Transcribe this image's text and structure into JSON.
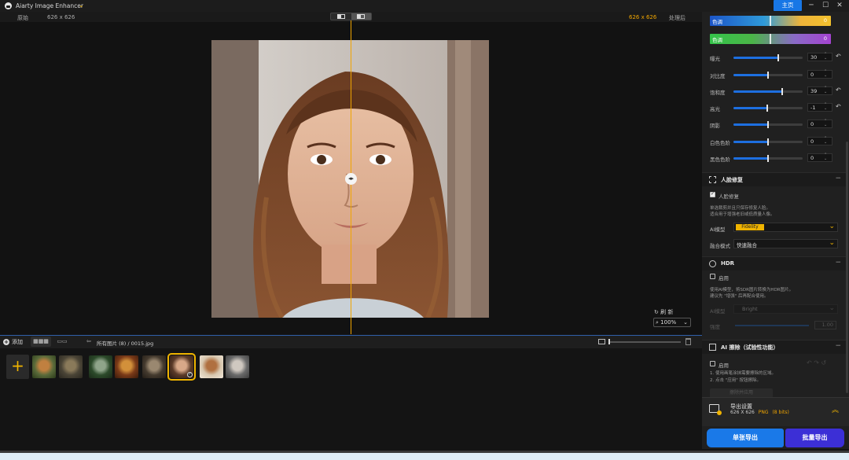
{
  "app": {
    "title": "Aiarty Image Enhancer",
    "home": "主页",
    "controls": [
      "─",
      "☐",
      "✕"
    ]
  },
  "compare": {
    "original": "原始",
    "after": "处理后",
    "size_left": "626 x 626",
    "size_right": "626 x 626"
  },
  "canvas": {
    "reset": "刷 新",
    "zoom": "100%"
  },
  "toolbar": {
    "add": "添加",
    "grid_icon": "▦▦▦",
    "list_icon": "▭▭",
    "breadcrumb": "所有图片 (8)  /  0015.jpg"
  },
  "gallery": {
    "add_symbol": "+",
    "thumbs": [
      {
        "name": "thumb-tiger",
        "colors": [
          "#5a6a3a",
          "#c08040",
          "#2a3a1a"
        ]
      },
      {
        "name": "thumb-owl",
        "colors": [
          "#4a4436",
          "#8a7a5a",
          "#2b2820"
        ]
      },
      {
        "name": "thumb-forest",
        "colors": [
          "#2c4a2a",
          "#8fa48a",
          "#1a2a18"
        ]
      },
      {
        "name": "thumb-food",
        "colors": [
          "#7a3a18",
          "#d2903a",
          "#3a1a0a"
        ]
      },
      {
        "name": "thumb-cat",
        "colors": [
          "#443a2e",
          "#9a8870",
          "#221c16"
        ]
      },
      {
        "name": "thumb-portrait",
        "colors": [
          "#5a3a28",
          "#d8a888",
          "#2a1a14"
        ],
        "selected": true
      },
      {
        "name": "thumb-dog",
        "colors": [
          "#d8c8b0",
          "#b07040",
          "#f0e6d8"
        ]
      },
      {
        "name": "thumb-street",
        "colors": [
          "#6a6a6a",
          "#cfc8c0",
          "#3a3a3a"
        ]
      }
    ]
  },
  "panel": {
    "hue_label": "色调",
    "hue_value": "0",
    "tone_label": "色调",
    "tone_value": "0",
    "adjustments": [
      {
        "label": "曝光",
        "value": "30",
        "level": 0.65,
        "undo": true
      },
      {
        "label": "对比度",
        "value": "0",
        "level": 0.5
      },
      {
        "label": "饱和度",
        "value": "39",
        "level": 0.7,
        "undo": true
      },
      {
        "label": "高光",
        "value": "-1",
        "level": 0.49,
        "undo": true
      },
      {
        "label": "阴影",
        "value": "0",
        "level": 0.5
      },
      {
        "label": "白色色阶",
        "value": "0",
        "level": 0.5
      },
      {
        "label": "黑色色阶",
        "value": "0",
        "level": 0.5
      }
    ],
    "face": {
      "title": "人脸修复",
      "checkbox": "人脸修复",
      "desc1": "单选裁剪并且只保存修复人脸。",
      "desc2": "适合用于增强老旧或低质量人像。",
      "model_label": "AI模型",
      "model_value": "Fidelity",
      "mode_label": "融合模式",
      "mode_value": "快速融合"
    },
    "hdr": {
      "title": "HDR",
      "checkbox": "启用",
      "desc1": "使用AI模型，将SDR图片转换为HDR图片。",
      "desc2": "建议先 \"增强\" 后再配合使用。",
      "model_label": "AI模型",
      "model_value": "Bright",
      "strength_label": "强度",
      "strength_value": "1.00"
    },
    "erase": {
      "title": "AI 擦除（试验性功能）",
      "checkbox": "启用",
      "desc1": "1. 使用画笔涂抹需要擦除的区域。",
      "desc2": "2. 点击 \"应用\" 按钮擦除。",
      "apply": "擦除并应用"
    },
    "export": {
      "title": "导出设置",
      "dims": "626 X 626",
      "format": "PNG",
      "bits": "(8 bits)"
    },
    "single_export": "单张导出",
    "batch_export": "批量导出"
  },
  "colors": {
    "accent": "#f0a500",
    "primary": "#1877e6",
    "batch": "#3c2fd6"
  }
}
